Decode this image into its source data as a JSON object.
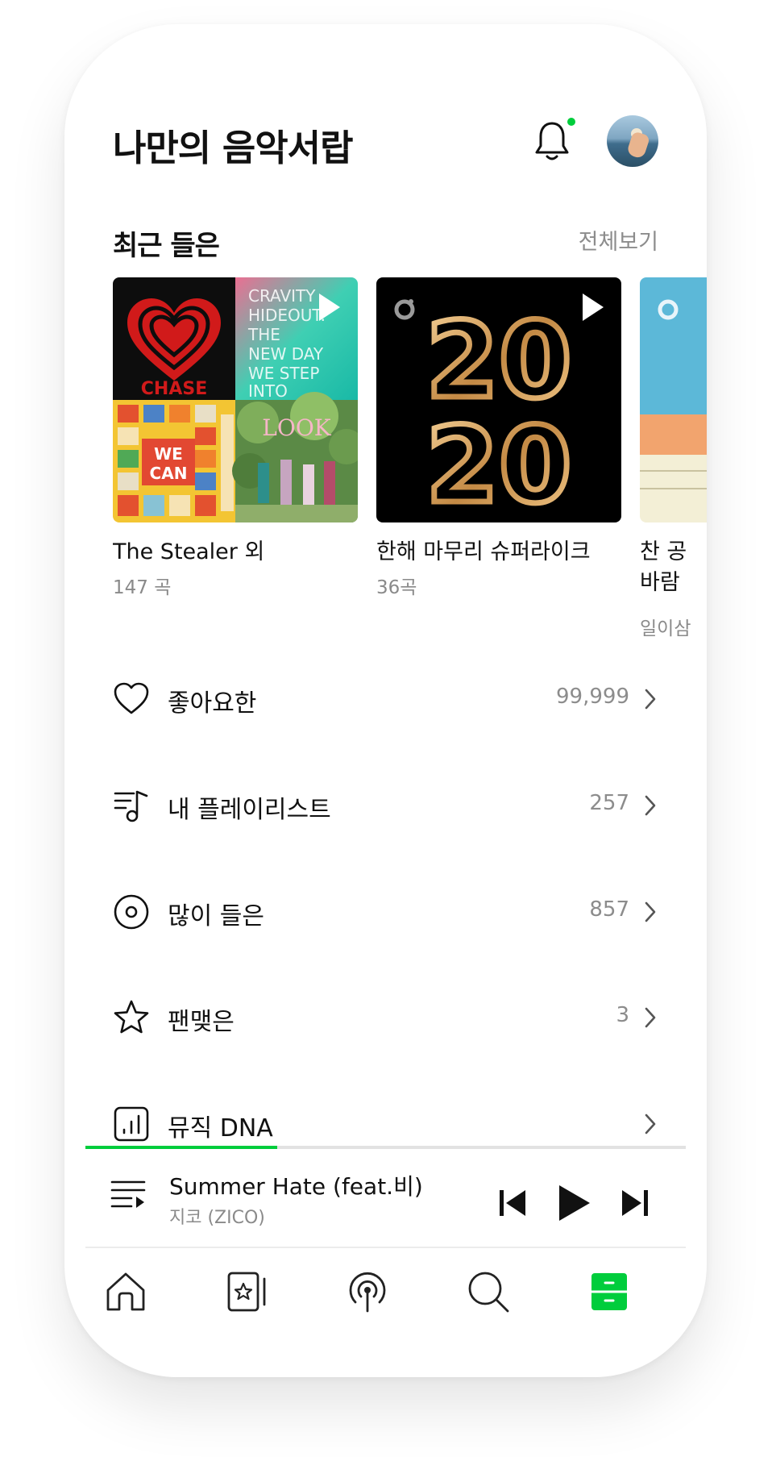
{
  "header": {
    "title": "나만의 음악서랍"
  },
  "icons": {
    "bell": "bell-icon",
    "avatar": "profile-avatar",
    "heart": "heart-icon",
    "playlist": "playlist-icon",
    "disc": "disc-icon",
    "star": "star-icon",
    "dna": "chart-icon",
    "chevron": "chevron-right-icon",
    "queue": "queue-list-icon",
    "prev": "skip-previous-icon",
    "play": "play-icon",
    "next": "skip-next-icon",
    "tabs": [
      "home-icon",
      "star-card-icon",
      "podcast-icon",
      "search-icon",
      "drawer-icon"
    ]
  },
  "recent": {
    "section_title": "최근 들은",
    "see_all_label": "전체보기",
    "items": [
      {
        "title": "The Stealer 외",
        "subtitle": "147 곡",
        "cover_text": [
          "CHASE",
          "CRAVITY",
          "HIDEOUT:",
          "THE",
          "NEW DAY",
          "WE STEP",
          "INTO",
          "WE",
          "CAN",
          "LOOK"
        ]
      },
      {
        "title": "한해 마무리 슈퍼라이크",
        "subtitle": "36곡",
        "cover_text": [
          "20",
          "20"
        ]
      },
      {
        "title_line1": "찬 공",
        "title_line2": "바람",
        "subtitle": "일이삼"
      }
    ]
  },
  "menu": [
    {
      "label": "좋아요한",
      "count": "99,999"
    },
    {
      "label": "내 플레이리스트",
      "count": "257"
    },
    {
      "label": "많이 들은",
      "count": "857"
    },
    {
      "label": "팬맺은",
      "count": "3"
    },
    {
      "label": "뮤직 DNA",
      "count": ""
    }
  ],
  "player": {
    "title": "Summer Hate (feat.비)",
    "artist": "지코 (ZICO)",
    "progress": 0.32
  },
  "colors": {
    "accent": "#00cd3c",
    "text": "#111111",
    "muted": "#8c8c8c"
  }
}
